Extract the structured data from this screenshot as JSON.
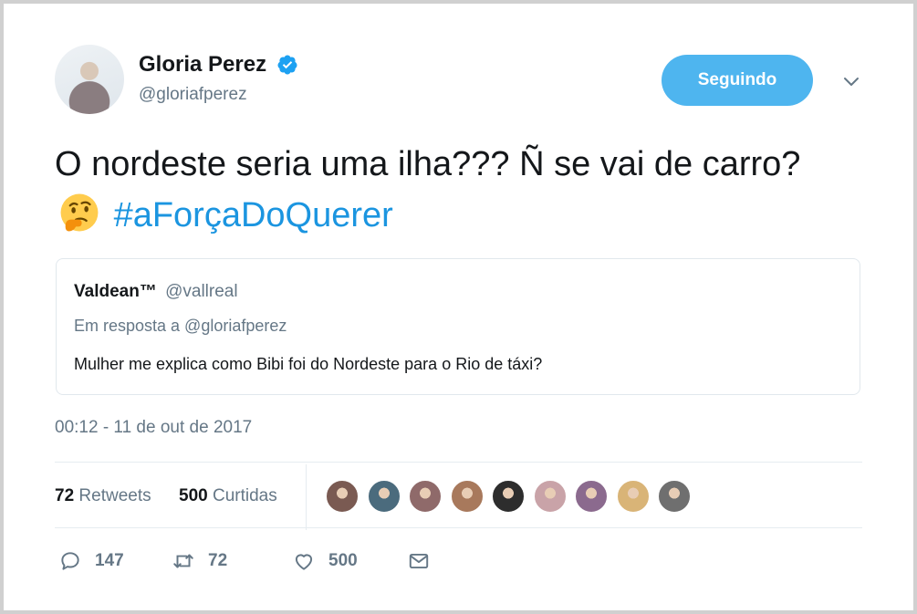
{
  "author": {
    "name": "Gloria Perez",
    "handle": "@gloriafperez",
    "verified": true,
    "avatar_icon": "avatar-photo"
  },
  "follow_button": {
    "label": "Seguindo",
    "color": "#4eb5ef"
  },
  "tweet": {
    "text": "O nordeste seria uma ilha??? Ñ se vai de carro?",
    "emoji": "thinking-face",
    "hashtag": "#aForçaDoQuerer"
  },
  "quoted": {
    "name": "Valdean™",
    "handle": "@vallreal",
    "reply_to": "Em resposta a @gloriafperez",
    "text": "Mulher me explica como Bibi foi do Nordeste para o Rio de táxi?"
  },
  "timestamp": "00:12 - 11 de out de 2017",
  "stats": {
    "retweets_count": "72",
    "retweets_label": "Retweets",
    "likes_count": "500",
    "likes_label": "Curtidas"
  },
  "likers": [
    {
      "color": "#7a5a52"
    },
    {
      "color": "#4b6b7d"
    },
    {
      "color": "#8f6a6a"
    },
    {
      "color": "#a8795c"
    },
    {
      "color": "#2d2d2d"
    },
    {
      "color": "#c9a3a8"
    },
    {
      "color": "#8b6a8e"
    },
    {
      "color": "#d9b477"
    },
    {
      "color": "#6f6f6f"
    }
  ],
  "actions": {
    "reply_count": "147",
    "retweet_count": "72",
    "like_count": "500"
  },
  "colors": {
    "link": "#1b95e0",
    "secondary_text": "#657786",
    "border": "#e1e8ed"
  }
}
